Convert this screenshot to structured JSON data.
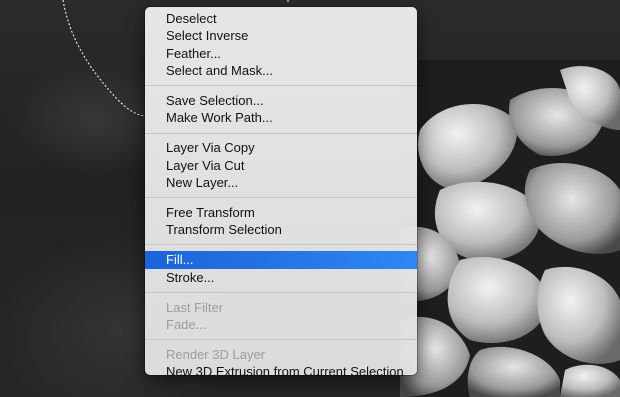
{
  "context_menu": {
    "groups": [
      {
        "items": [
          {
            "label": "Deselect",
            "state": "enabled"
          },
          {
            "label": "Select Inverse",
            "state": "enabled"
          },
          {
            "label": "Feather...",
            "state": "enabled"
          },
          {
            "label": "Select and Mask...",
            "state": "enabled"
          }
        ]
      },
      {
        "items": [
          {
            "label": "Save Selection...",
            "state": "enabled"
          },
          {
            "label": "Make Work Path...",
            "state": "enabled"
          }
        ]
      },
      {
        "items": [
          {
            "label": "Layer Via Copy",
            "state": "enabled"
          },
          {
            "label": "Layer Via Cut",
            "state": "enabled"
          },
          {
            "label": "New Layer...",
            "state": "enabled"
          }
        ]
      },
      {
        "items": [
          {
            "label": "Free Transform",
            "state": "enabled"
          },
          {
            "label": "Transform Selection",
            "state": "enabled"
          }
        ]
      },
      {
        "items": [
          {
            "label": "Fill...",
            "state": "highlighted"
          },
          {
            "label": "Stroke...",
            "state": "enabled"
          }
        ]
      },
      {
        "items": [
          {
            "label": "Last Filter",
            "state": "disabled"
          },
          {
            "label": "Fade...",
            "state": "disabled"
          }
        ]
      },
      {
        "items": [
          {
            "label": "Render 3D Layer",
            "state": "disabled"
          },
          {
            "label": "New 3D Extrusion from Current Selection",
            "state": "enabled"
          }
        ]
      }
    ]
  },
  "colors": {
    "highlight": "#1d6ce5",
    "menu_background": "#e6e6e6",
    "disabled_text": "#9d9d9d",
    "canvas_background": "#1c1c1c"
  }
}
